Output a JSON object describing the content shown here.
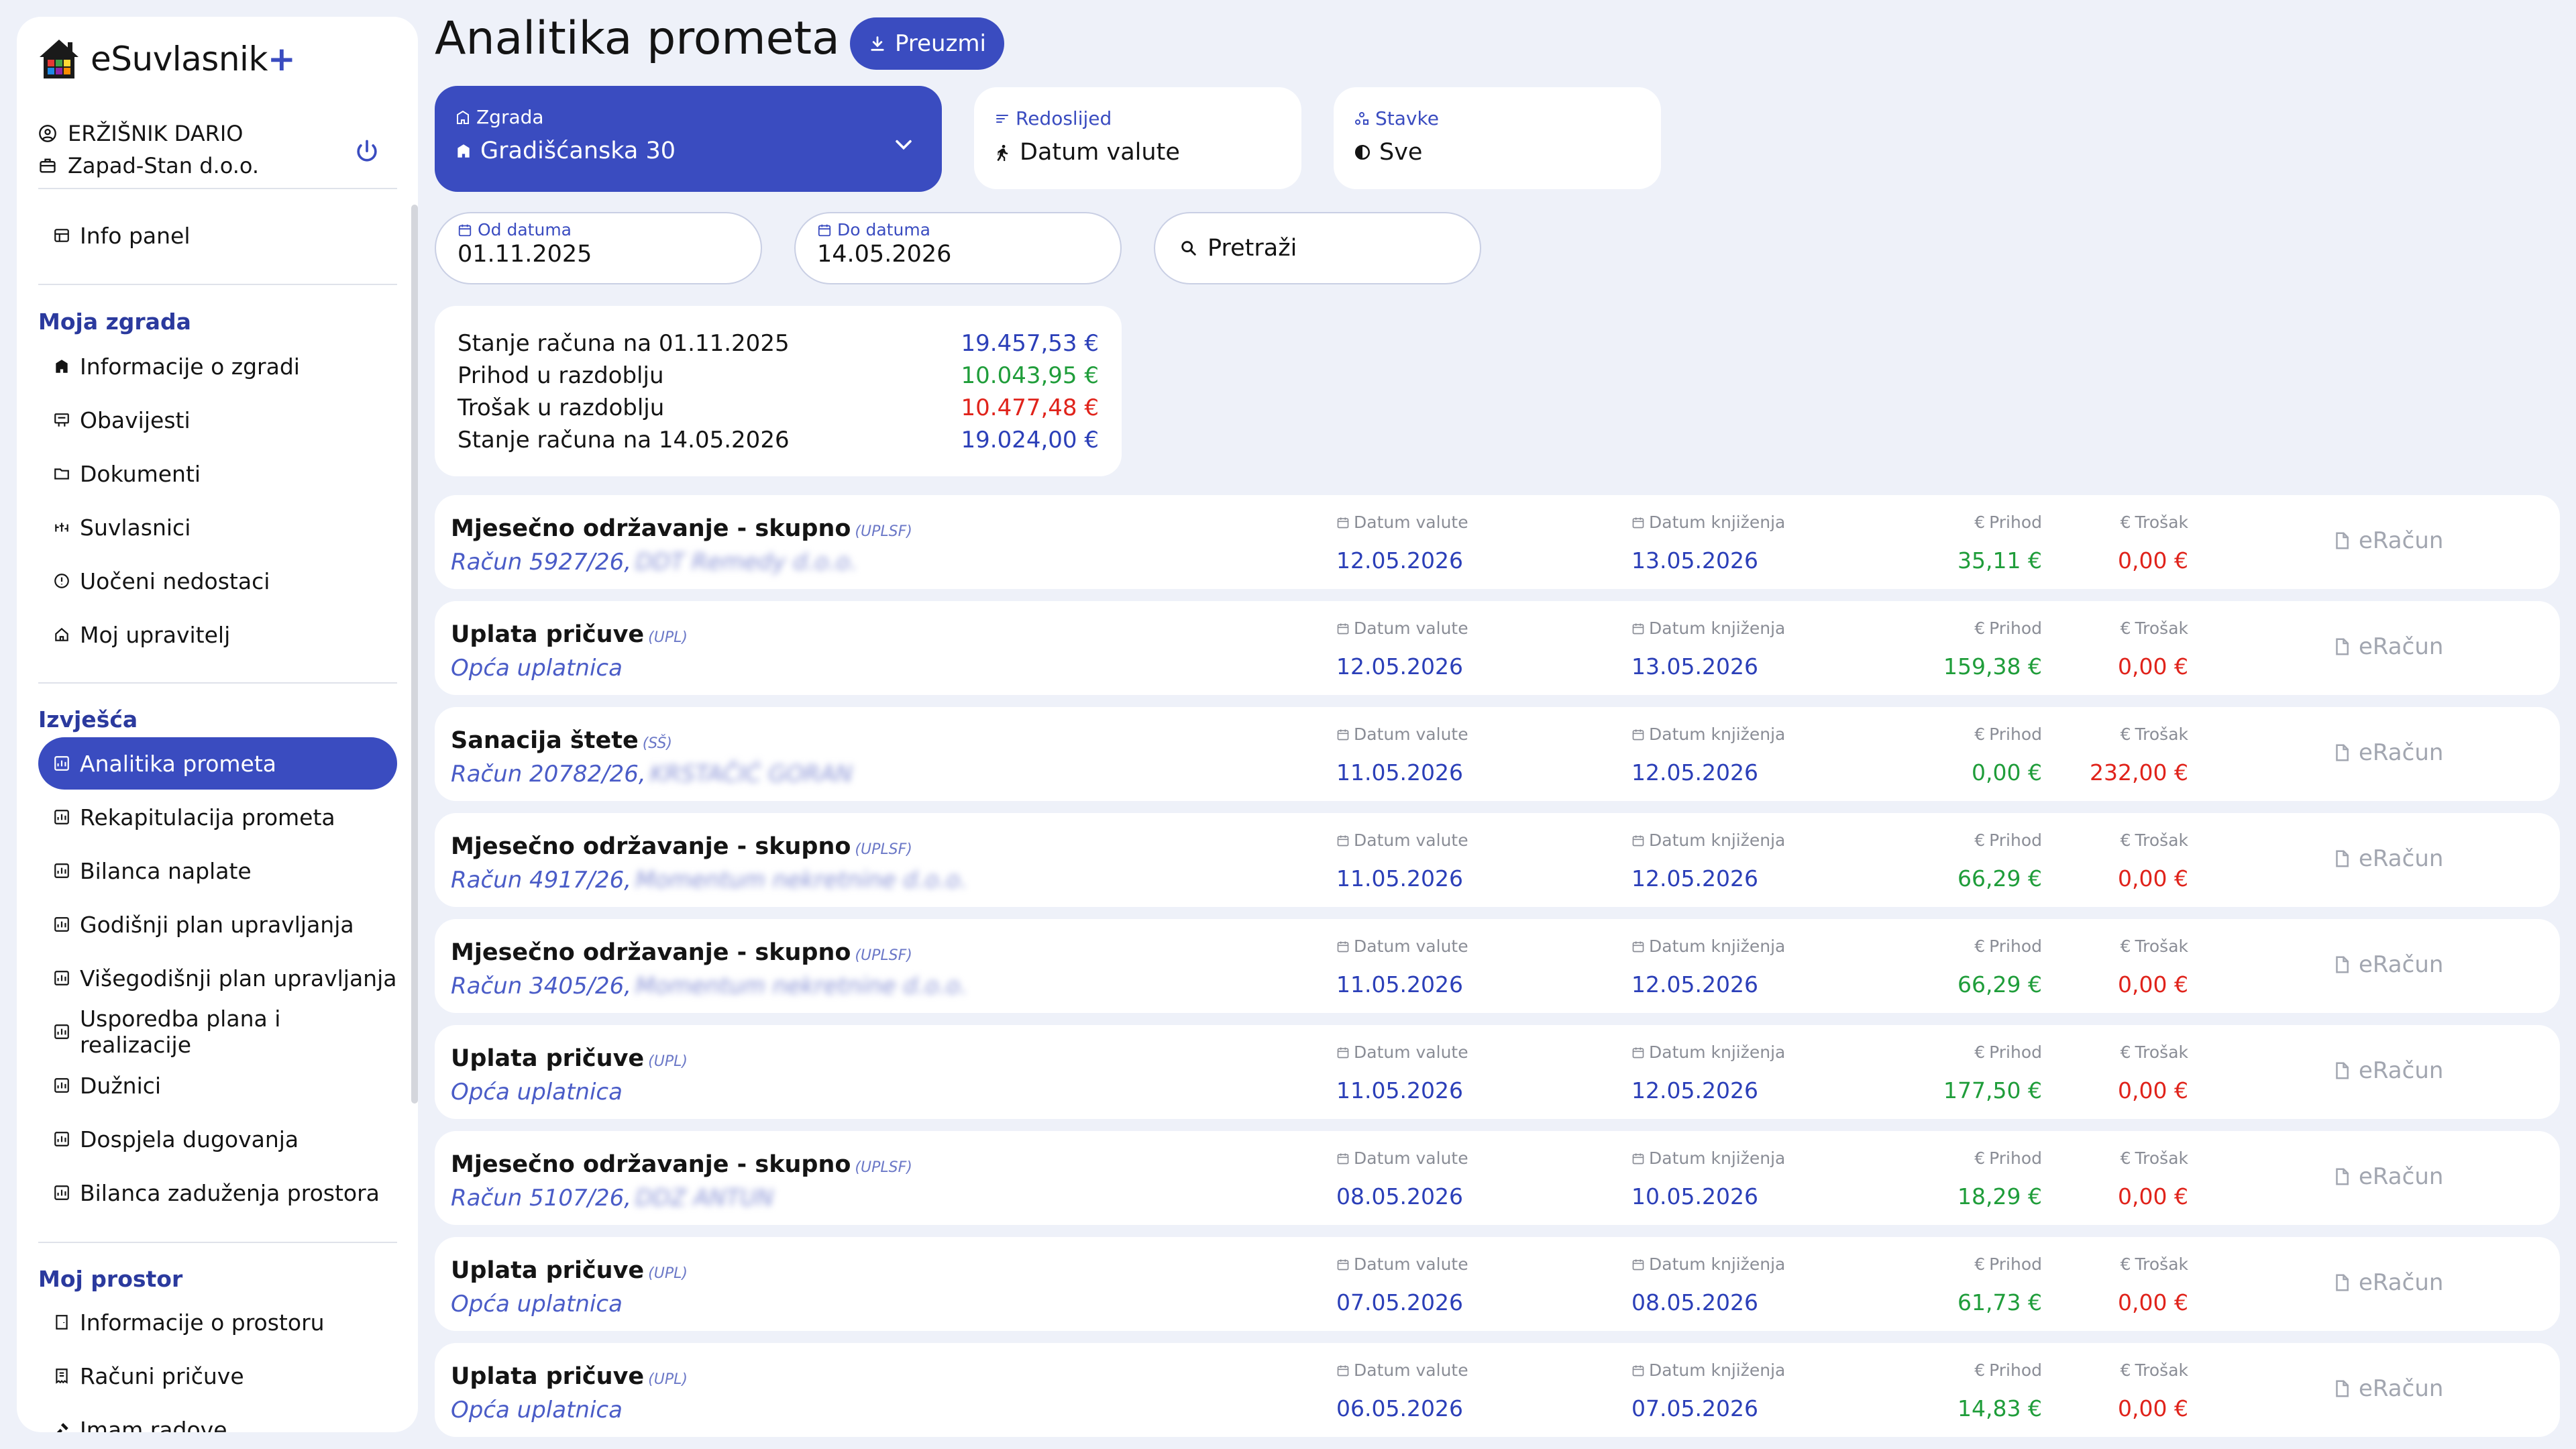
{
  "app": {
    "name": "eSuvlasnik",
    "name_plus": "+",
    "user_name": "ERŽIŠNIK DARIO",
    "company": "Zapad-Stan d.o.o."
  },
  "sidebar": {
    "info_panel": "Info panel",
    "sections": [
      {
        "title": "Moja zgrada",
        "items": [
          "Informacije o zgradi",
          "Obavijesti",
          "Dokumenti",
          "Suvlasnici",
          "Uočeni nedostaci",
          "Moj upravitelj"
        ]
      },
      {
        "title": "Izvješća",
        "items": [
          "Analitika prometa",
          "Rekapitulacija prometa",
          "Bilanca naplate",
          "Godišnji plan upravljanja",
          "Višegodišnji plan upravljanja",
          "Usporedba plana i realizacije",
          "Dužnici",
          "Dospjela dugovanja",
          "Bilanca zaduženja prostora"
        ]
      },
      {
        "title": "Moj prostor",
        "items": [
          "Informacije o prostoru",
          "Računi pričuve",
          "Imam radove"
        ]
      }
    ],
    "active_item": "Analitika prometa"
  },
  "header": {
    "title": "Analitika prometa",
    "download_label": "Preuzmi"
  },
  "filters": {
    "building": {
      "label": "Zgrada",
      "value": "Gradišćanska 30"
    },
    "order": {
      "label": "Redoslijed",
      "value": "Datum valute"
    },
    "items": {
      "label": "Stavke",
      "value": "Sve"
    },
    "from_date": {
      "label": "Od datuma",
      "value": "01.11.2025"
    },
    "to_date": {
      "label": "Do datuma",
      "value": "14.05.2026"
    },
    "search_placeholder": "Pretraži"
  },
  "summary": [
    {
      "label": "Stanje računa na 01.11.2025",
      "value": "19.457,53 €",
      "color": "#2b3fb8"
    },
    {
      "label": "Prihod u razdoblju",
      "value": "10.043,95 €",
      "color": "#1f9d3a"
    },
    {
      "label": "Trošak u razdoblju",
      "value": "10.477,48 €",
      "color": "#e0231b"
    },
    {
      "label": "Stanje računa na 14.05.2026",
      "value": "19.024,00 €",
      "color": "#2b3fb8"
    }
  ],
  "columns": {
    "value_date": "Datum valute",
    "booking_date": "Datum knjiženja",
    "income": "Prihod",
    "cost": "Trošak",
    "einvoice": "eRačun"
  },
  "transactions": [
    {
      "title": "Mjesečno održavanje - skupno",
      "code": "(UPLSF)",
      "sub": "Račun 5927/26,",
      "party": "DDT Remedy d.o.o.",
      "value_date": "12.05.2026",
      "booking_date": "13.05.2026",
      "income": "35,11 €",
      "cost": "0,00 €"
    },
    {
      "title": "Uplata pričuve",
      "code": "(UPL)",
      "sub": "Opća uplatnica",
      "party": "",
      "value_date": "12.05.2026",
      "booking_date": "13.05.2026",
      "income": "159,38 €",
      "cost": "0,00 €"
    },
    {
      "title": "Sanacija štete",
      "code": "(SŠ)",
      "sub": "Račun 20782/26,",
      "party": "KRSTAČIĆ GORAN",
      "value_date": "11.05.2026",
      "booking_date": "12.05.2026",
      "income": "0,00 €",
      "cost": "232,00 €"
    },
    {
      "title": "Mjesečno održavanje - skupno",
      "code": "(UPLSF)",
      "sub": "Račun 4917/26,",
      "party": "Momentum nekretnine d.o.o.",
      "value_date": "11.05.2026",
      "booking_date": "12.05.2026",
      "income": "66,29 €",
      "cost": "0,00 €"
    },
    {
      "title": "Mjesečno održavanje - skupno",
      "code": "(UPLSF)",
      "sub": "Račun 3405/26,",
      "party": "Momentum nekretnine d.o.o.",
      "value_date": "11.05.2026",
      "booking_date": "12.05.2026",
      "income": "66,29 €",
      "cost": "0,00 €"
    },
    {
      "title": "Uplata pričuve",
      "code": "(UPL)",
      "sub": "Opća uplatnica",
      "party": "",
      "value_date": "11.05.2026",
      "booking_date": "12.05.2026",
      "income": "177,50 €",
      "cost": "0,00 €"
    },
    {
      "title": "Mjesečno održavanje - skupno",
      "code": "(UPLSF)",
      "sub": "Račun 5107/26,",
      "party": "DDZ ANTUN",
      "value_date": "08.05.2026",
      "booking_date": "10.05.2026",
      "income": "18,29 €",
      "cost": "0,00 €"
    },
    {
      "title": "Uplata pričuve",
      "code": "(UPL)",
      "sub": "Opća uplatnica",
      "party": "",
      "value_date": "07.05.2026",
      "booking_date": "08.05.2026",
      "income": "61,73 €",
      "cost": "0,00 €"
    },
    {
      "title": "Uplata pričuve",
      "code": "(UPL)",
      "sub": "Opća uplatnica",
      "party": "",
      "value_date": "06.05.2026",
      "booking_date": "07.05.2026",
      "income": "14,83 €",
      "cost": "0,00 €"
    }
  ],
  "colors": {
    "accent": "#3a4cc0",
    "income": "#1f9d3a",
    "cost": "#e0231b",
    "date": "#2b3fb8",
    "background": "#eef1f9"
  }
}
